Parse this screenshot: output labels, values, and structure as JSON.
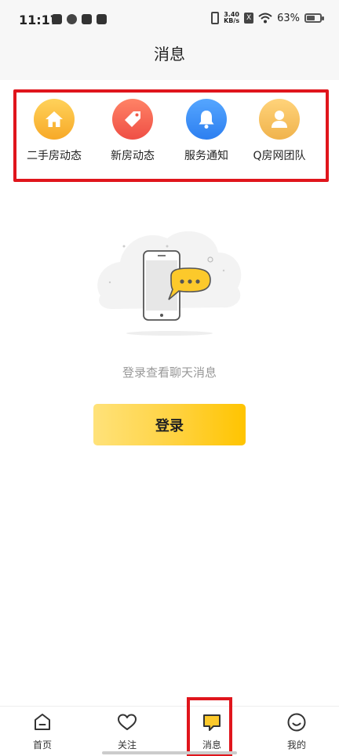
{
  "status_bar": {
    "time": "11:17",
    "net_speed_top": "3.40",
    "net_speed_bottom": "KB/s",
    "sim_icon": "X",
    "battery": "63%",
    "battery_level": 0.63
  },
  "header": {
    "title": "消息"
  },
  "categories": [
    {
      "label": "二手房动态",
      "icon": "house-icon",
      "color": "#f9b53b"
    },
    {
      "label": "新房动态",
      "icon": "tag-icon",
      "color": "#f46450"
    },
    {
      "label": "服务通知",
      "icon": "bell-icon",
      "color": "#3a8df5"
    },
    {
      "label": "Q房网团队",
      "icon": "person-icon",
      "color": "#f2bf60"
    }
  ],
  "empty_state": {
    "message": "登录查看聊天消息",
    "login_label": "登录"
  },
  "bottom_nav": [
    {
      "label": "首页",
      "icon": "home-icon"
    },
    {
      "label": "关注",
      "icon": "heart-icon"
    },
    {
      "label": "消息",
      "icon": "message-icon",
      "active": true
    },
    {
      "label": "我的",
      "icon": "smiley-icon"
    }
  ],
  "colors": {
    "accent": "#ffd23f",
    "highlight": "#e0151c"
  }
}
